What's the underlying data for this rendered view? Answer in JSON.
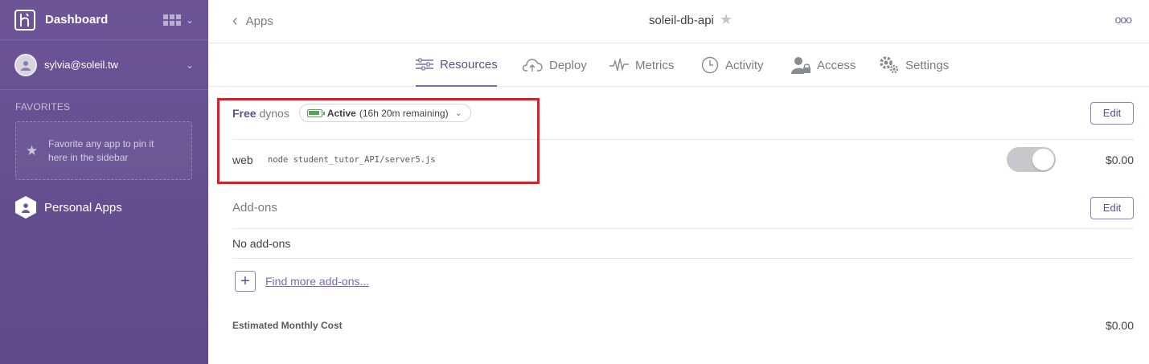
{
  "sidebar": {
    "title": "Dashboard",
    "user": "sylvia@soleil.tw",
    "favorites_heading": "FAVORITES",
    "favorites_hint": "Favorite any app to pin it here in the sidebar",
    "personal_apps": "Personal Apps"
  },
  "header": {
    "back_label": "Apps",
    "app_name": "soleil-db-api",
    "more": "ooo"
  },
  "tabs": [
    {
      "label": "Resources",
      "icon": "sliders-icon",
      "active": true
    },
    {
      "label": "Deploy",
      "icon": "cloud-upload-icon",
      "active": false
    },
    {
      "label": "Metrics",
      "icon": "pulse-icon",
      "active": false
    },
    {
      "label": "Activity",
      "icon": "clock-icon",
      "active": false
    },
    {
      "label": "Access",
      "icon": "user-lock-icon",
      "active": false
    },
    {
      "label": "Settings",
      "icon": "gears-icon",
      "active": false
    }
  ],
  "dynos": {
    "plan": "Free",
    "label": "dynos",
    "status_active": "Active",
    "status_remaining": "(16h 20m remaining)",
    "edit_label": "Edit",
    "process": {
      "type": "web",
      "command": "node student_tutor_API/server5.js",
      "enabled": true,
      "cost": "$0.00"
    }
  },
  "addons": {
    "title": "Add-ons",
    "edit_label": "Edit",
    "empty": "No add-ons",
    "find_more": "Find more add-ons..."
  },
  "estimate": {
    "label": "Estimated Monthly Cost",
    "value": "$0.00"
  },
  "colors": {
    "sidebar": "#6c5497",
    "accent": "#7c6ab0",
    "highlight": "#e01d24",
    "battery": "#5ba05b"
  }
}
